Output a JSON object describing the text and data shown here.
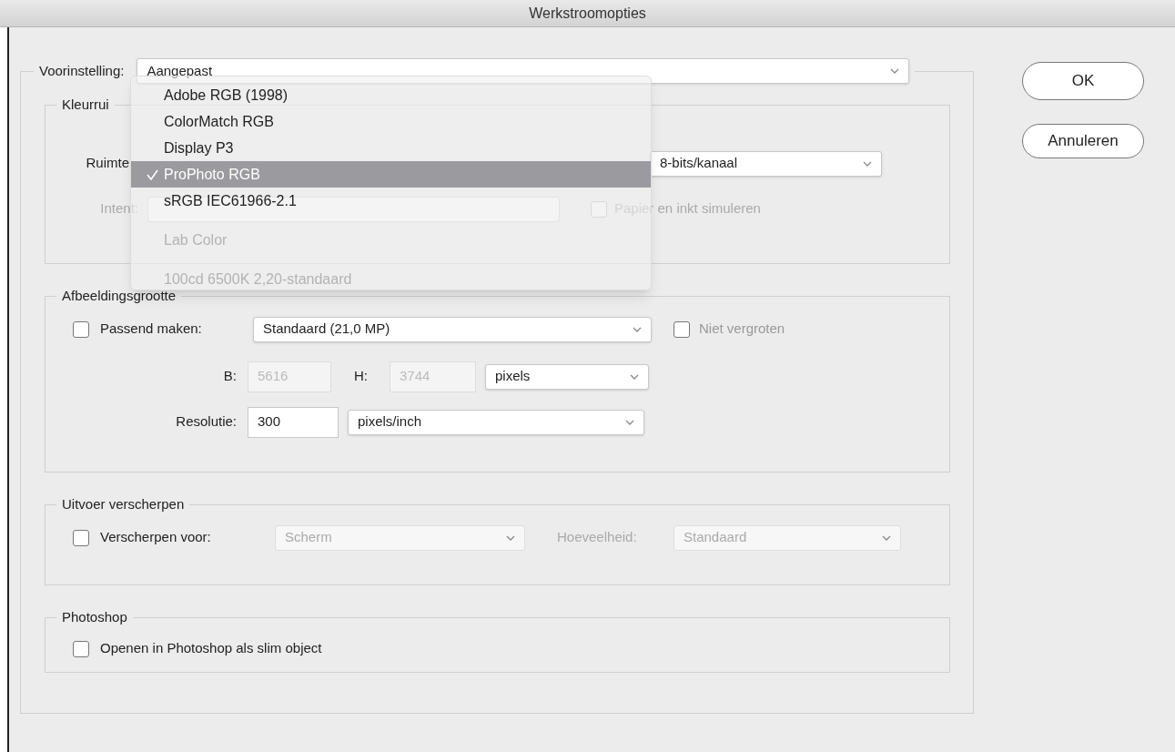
{
  "window": {
    "title": "Werkstroomopties"
  },
  "preset": {
    "label": "Voorinstelling:",
    "value": "Aangepast"
  },
  "buttons": [
    {
      "label": "OK"
    },
    {
      "label": "Annuleren"
    }
  ],
  "color_space": {
    "title": "Kleurrui",
    "space_label": "Ruimte",
    "depth": {
      "value": "8-bits/kanaal",
      "disabled": false
    },
    "intent_label": "Intent:",
    "simulate": {
      "label": "Papier en inkt simuleren",
      "checked": false,
      "disabled": true
    }
  },
  "space_menu": {
    "items": [
      {
        "kind": "item",
        "label": "Adobe RGB (1998)",
        "selected": false,
        "disabled": false
      },
      {
        "kind": "item",
        "label": "ColorMatch RGB",
        "selected": false,
        "disabled": false
      },
      {
        "kind": "item",
        "label": "Display P3",
        "selected": false,
        "disabled": false
      },
      {
        "kind": "item",
        "label": "ProPhoto RGB",
        "selected": true,
        "disabled": false
      },
      {
        "kind": "item",
        "label": "sRGB IEC61966-2.1",
        "selected": false,
        "disabled": false
      },
      {
        "kind": "separator"
      },
      {
        "kind": "item",
        "label": "Lab Color",
        "selected": false,
        "disabled": true
      },
      {
        "kind": "separator"
      },
      {
        "kind": "item",
        "label": "100cd 6500K 2,20-standaard",
        "selected": false,
        "disabled": true
      }
    ]
  },
  "image_size": {
    "title": "Afbeeldingsgrootte",
    "fit": {
      "label": "Passend maken:",
      "checked": false
    },
    "fit_value": {
      "value": "Standaard (21,0 MP)",
      "disabled": false
    },
    "no_enlarge": {
      "label": "Niet vergroten",
      "checked": false,
      "disabled": false
    },
    "width_label": "B:",
    "width": {
      "value": "5616",
      "disabled": true
    },
    "height_label": "H:",
    "height": {
      "value": "3744",
      "disabled": true
    },
    "unit": {
      "value": "pixels",
      "disabled": false
    },
    "resolution_label": "Resolutie:",
    "resolution": {
      "value": "300",
      "disabled": false
    },
    "resolution_unit": {
      "value": "pixels/inch",
      "disabled": false
    }
  },
  "sharpen": {
    "title": "Uitvoer verscherpen",
    "for": {
      "label": "Verscherpen voor:",
      "checked": false,
      "disabled": false
    },
    "for_value": {
      "value": "Scherm",
      "disabled": true
    },
    "amount_label": "Hoeveelheid:",
    "amount_value": {
      "value": "Standaard",
      "disabled": true
    }
  },
  "photoshop": {
    "title": "Photoshop",
    "smart_object": {
      "label": "Openen in Photoshop als slim object",
      "checked": false,
      "disabled": false
    }
  }
}
